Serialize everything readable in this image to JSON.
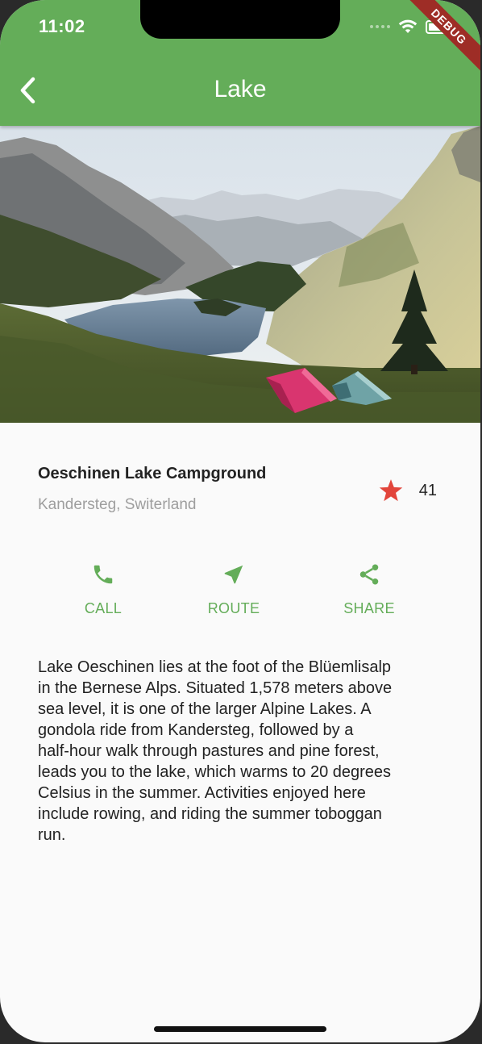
{
  "status_bar": {
    "time": "11:02",
    "debug_label": "DEBUG"
  },
  "app_bar": {
    "title": "Lake",
    "back_icon": "chevron-left-icon",
    "color": "#64ad59"
  },
  "hero_image": {
    "description": "mountain-lake-campground-photo"
  },
  "place": {
    "name": "Oeschinen Lake Campground",
    "location": "Kandersteg, Switerland",
    "rating_icon": "star-icon",
    "rating_color": "#e2453b",
    "rating_count": "41"
  },
  "actions": [
    {
      "label": "CALL",
      "icon": "phone-icon"
    },
    {
      "label": "ROUTE",
      "icon": "navigation-arrow-icon"
    },
    {
      "label": "SHARE",
      "icon": "share-icon"
    }
  ],
  "accent_color": "#64ad59",
  "description_lines": [
    "Lake Oeschinen lies at the foot of the Blüemlisalp",
    "in the Bernese Alps. Situated 1,578 meters above",
    "sea level, it is one of the larger Alpine Lakes. A",
    "gondola ride from Kandersteg, followed by a",
    "half-hour walk through pastures and pine forest,",
    "leads you to the lake, which warms to 20 degrees",
    "Celsius in the summer. Activities enjoyed here",
    "include rowing, and riding the summer toboggan",
    "run."
  ]
}
